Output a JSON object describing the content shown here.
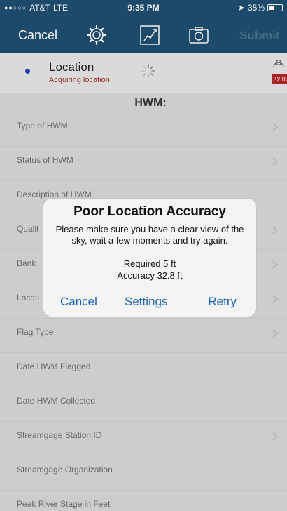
{
  "status_bar": {
    "carrier": "AT&T",
    "network": "LTE",
    "time": "9:35 PM",
    "battery": "35%"
  },
  "nav": {
    "cancel_label": "Cancel",
    "submit_label": "Submit",
    "icons": [
      "gear-icon",
      "sketch-icon",
      "camera-icon"
    ]
  },
  "location": {
    "title": "Location",
    "status": "Acquiring location",
    "accuracy_badge": "32.8"
  },
  "form": {
    "section_title": "HWM:",
    "fields": [
      {
        "label": "Type of HWM"
      },
      {
        "label": "Status of HWM"
      },
      {
        "label": "Description of HWM"
      },
      {
        "label": "Qualit"
      },
      {
        "label": "Bank"
      },
      {
        "label": "Locati"
      },
      {
        "label": "Flag Type"
      },
      {
        "label": "Date HWM Flagged"
      },
      {
        "label": "Date HWM Collected"
      },
      {
        "label": "Streamgage Station ID"
      },
      {
        "label": "Streamgage Organization"
      },
      {
        "label": "Peak River Stage in Feet"
      }
    ]
  },
  "alert": {
    "title": "Poor Location Accuracy",
    "message": "Please make sure you have a clear view of the sky, wait a few moments and try again.",
    "required": "Required 5 ft",
    "accuracy": "Accuracy 32.8 ft",
    "buttons": {
      "cancel": "Cancel",
      "settings": "Settings",
      "retry": "Retry"
    }
  },
  "colors": {
    "nav_background": "#1f4e70",
    "alert_button": "#1e64b4",
    "location_status": "#a03030",
    "badge": "#b22525"
  }
}
